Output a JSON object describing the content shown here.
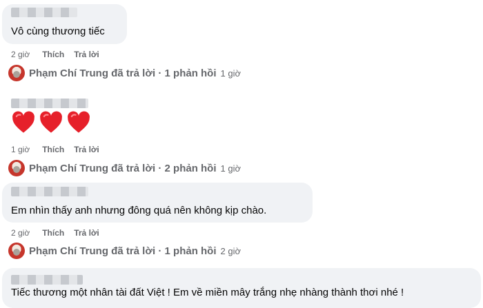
{
  "comments": [
    {
      "text": "Vô cùng thương tiếc",
      "actions": {
        "time": "2 giờ",
        "like": "Thích",
        "reply": "Trả lời"
      },
      "reply_summary": {
        "author": "Phạm Chí Trung",
        "text": "Phạm Chí Trung đã trả lời · 1 phản hồi",
        "time": "1 giờ"
      }
    },
    {
      "emoji": "❤️❤️❤️",
      "actions": {
        "time": "1 giờ",
        "like": "Thích",
        "reply": "Trả lời"
      },
      "reply_summary": {
        "author": "Phạm Chí Trung",
        "text": "Phạm Chí Trung đã trả lời · 2 phản hồi",
        "time": "1 giờ"
      }
    },
    {
      "text": "Em nhìn thấy anh nhưng đông quá nên không kịp chào.",
      "actions": {
        "time": "2 giờ",
        "like": "Thích",
        "reply": "Trả lời"
      },
      "reply_summary": {
        "author": "Phạm Chí Trung",
        "text": "Phạm Chí Trung đã trả lời · 1 phản hồi",
        "time": "2 giờ"
      }
    },
    {
      "text": "Tiếc thương một nhân tài đất Việt ! Em về miền mây trắng nhẹ nhàng thành thơi nhé !"
    }
  ]
}
